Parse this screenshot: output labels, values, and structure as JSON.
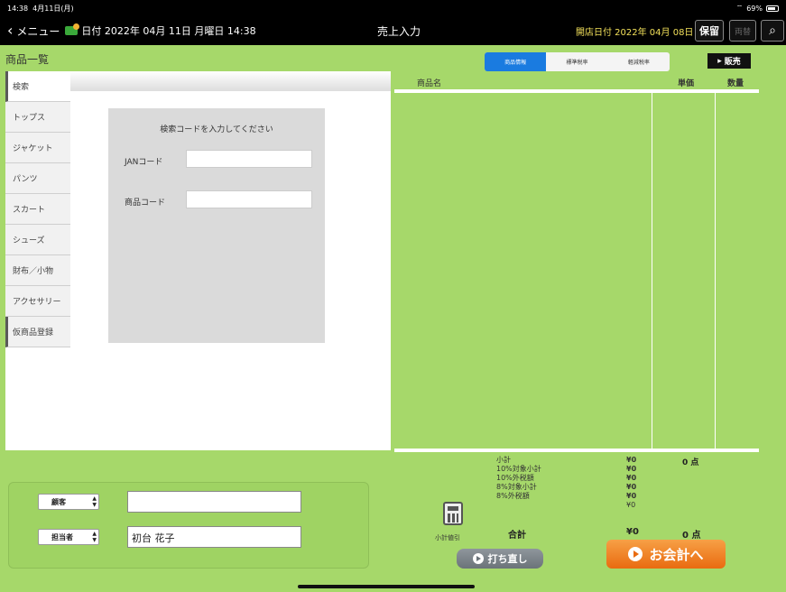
{
  "status": {
    "time": "14:38",
    "date": "4月11日(月)",
    "battery": "69%"
  },
  "nav": {
    "back_label": "メニュー",
    "date_label": "日付 2022年 04月 11日 月曜日 14:38",
    "title": "売上入力",
    "open_date": "開店日付 2022年 04月 08日",
    "hold_label": "保留",
    "disabled_label": "両替"
  },
  "panel": {
    "title": "商品一覧",
    "tabs": [
      "検索",
      "トップス",
      "ジャケット",
      "パンツ",
      "スカート",
      "シューズ",
      "財布／小物",
      "アクセサリー",
      "仮商品登録"
    ]
  },
  "search": {
    "title": "検索コードを入力してください",
    "jan_label": "JANコード",
    "product_label": "商品コード"
  },
  "segments": [
    "商品情報",
    "標準税率",
    "軽減税率"
  ],
  "sale_label": "販売",
  "columns": {
    "name": "商品名",
    "price": "単価",
    "qty": "数量"
  },
  "summary": {
    "labels": [
      "小計",
      "10%対象小計",
      "10%外税額",
      "8%対象小計",
      "8%外税額"
    ],
    "values": [
      "¥0",
      "¥0",
      "¥0",
      "¥0",
      "¥0",
      "¥0"
    ],
    "points": "0 点",
    "total_label": "合計",
    "total_value": "¥0",
    "total_points": "0 点"
  },
  "calc_label": "小計値引",
  "redo_label": "打ち直し",
  "pay_label": "お会計へ",
  "customer": {
    "customer_label": "顧客",
    "staff_label": "担当者",
    "customer_value": "",
    "staff_value": "初台 花子"
  }
}
